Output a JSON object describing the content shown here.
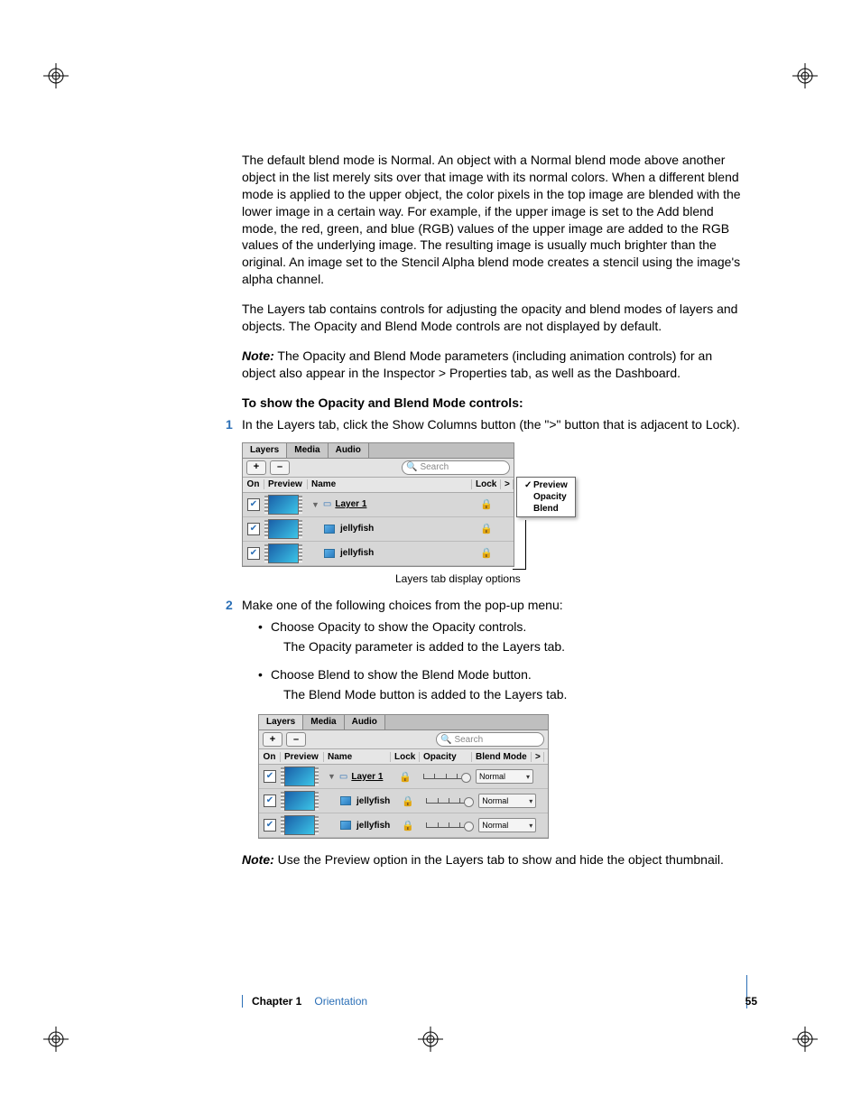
{
  "paragraphs": {
    "p1": "The default blend mode is Normal. An object with a Normal blend mode above another object in the list merely sits over that image with its normal colors. When a different blend mode is applied to the upper object, the color pixels in the top image are blended with the lower image in a certain way. For example, if the upper image is set to the Add blend mode, the red, green, and blue (RGB) values of the upper image are added to the RGB values of the underlying image. The resulting image is usually much brighter than the original. An image set to the Stencil Alpha blend mode creates a stencil using the image's alpha channel.",
    "p2": "The Layers tab contains controls for adjusting the opacity and blend modes of layers and objects. The Opacity and Blend Mode controls are not displayed by default.",
    "note_label": "Note:",
    "p3": "  The Opacity and Blend Mode parameters (including animation controls) for an object also appear in the Inspector > Properties tab, as well as the Dashboard.",
    "heading": "To show the Opacity and Blend Mode controls:",
    "step1_num": "1",
    "step1": "In the Layers tab, click the Show Columns button (the \">\" button that is adjacent to Lock).",
    "caption1": "Layers tab display options",
    "step2_num": "2",
    "step2": "Make one of the following choices from the pop-up menu:",
    "b1": "Choose Opacity to show the Opacity controls.",
    "b1_sub": "The Opacity parameter is added to the Layers tab.",
    "b2": "Choose Blend to show the Blend Mode button.",
    "b2_sub": "The Blend Mode button is added to the Layers tab.",
    "note2_label": "Note:",
    "p4": "  Use the Preview option in the Layers tab to show and hide the object thumbnail."
  },
  "panel": {
    "tabs": [
      "Layers",
      "Media",
      "Audio"
    ],
    "plus": "+",
    "minus": "–",
    "search_placeholder": "Search",
    "headers": {
      "on": "On",
      "preview": "Preview",
      "name": "Name",
      "lock": "Lock",
      "opacity": "Opacity",
      "blend": "Blend Mode"
    },
    "rows": [
      {
        "name": "Layer 1",
        "indent": 0,
        "group": true
      },
      {
        "name": "jellyfish",
        "indent": 1,
        "group": false
      },
      {
        "name": "jellyfish",
        "indent": 1,
        "group": false
      }
    ],
    "blend_value": "Normal",
    "expand": ">"
  },
  "popup": {
    "items": [
      {
        "checked": true,
        "label": "Preview"
      },
      {
        "checked": false,
        "label": "Opacity"
      },
      {
        "checked": false,
        "label": "Blend"
      }
    ]
  },
  "panel2_width_note": "panel with extra columns",
  "footer": {
    "chapter": "Chapter 1",
    "title": "Orientation",
    "page": "55"
  }
}
